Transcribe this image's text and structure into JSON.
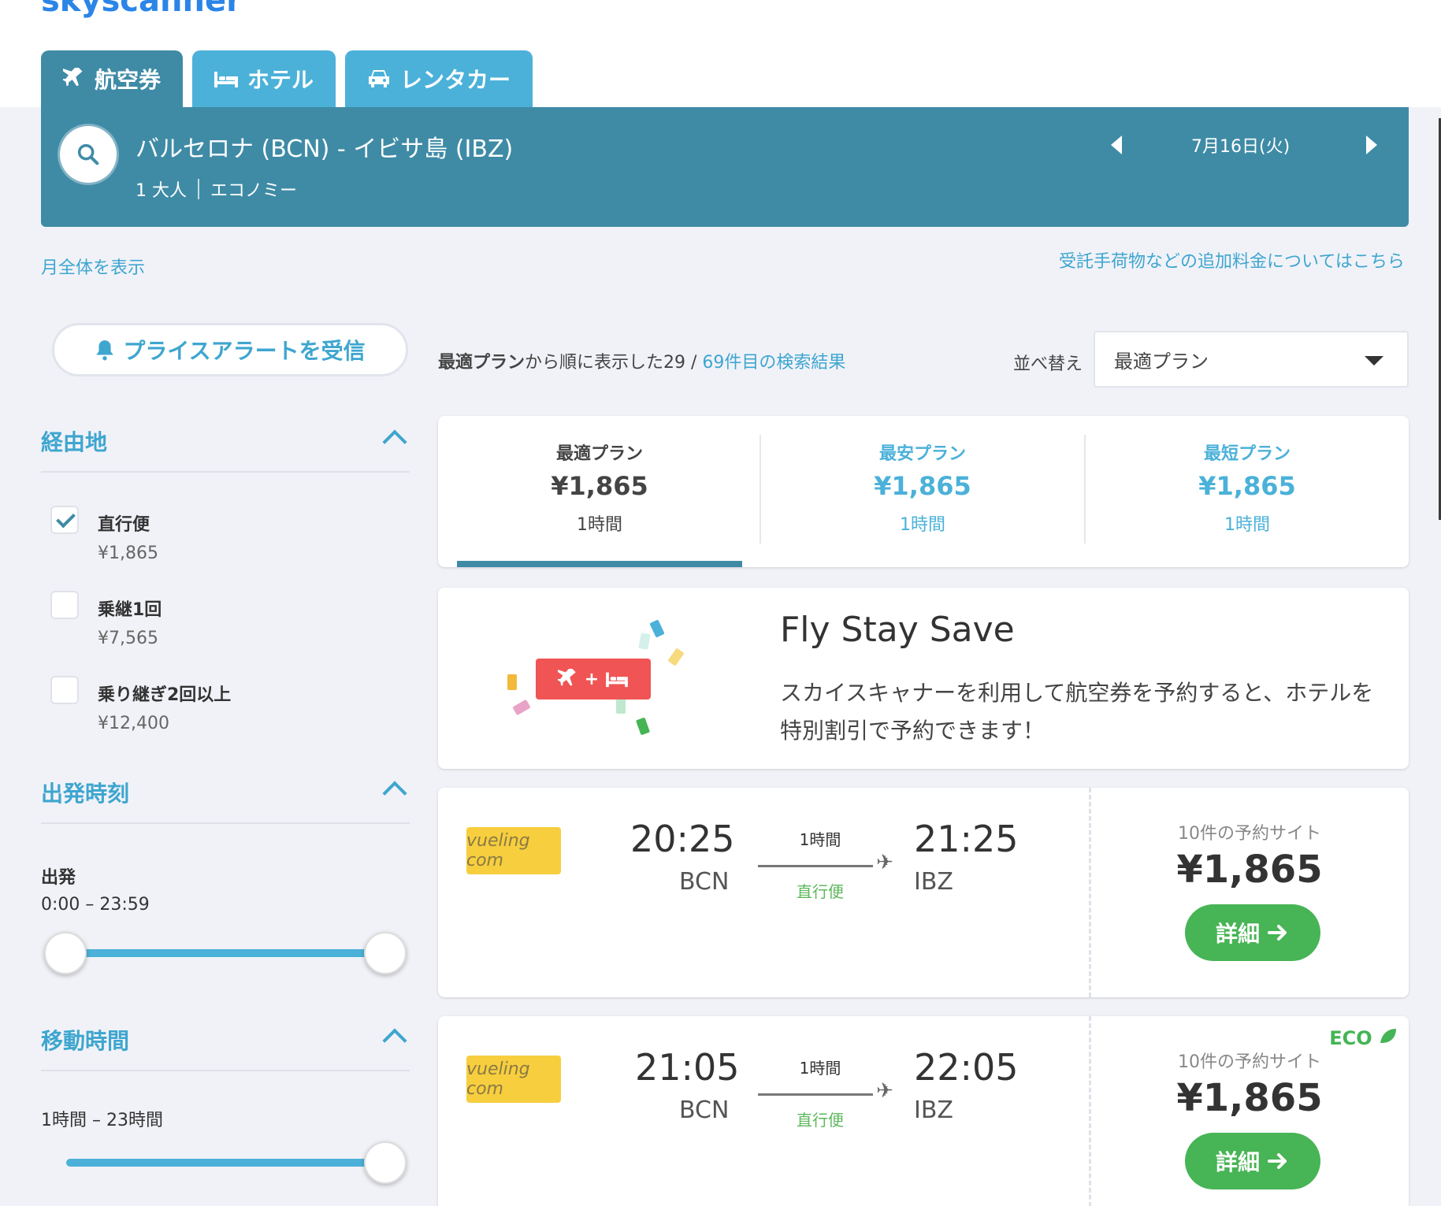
{
  "brand": {
    "logo_text": "skyscanner"
  },
  "tabs": [
    {
      "label": "航空券",
      "icon": "plane-icon",
      "active": true
    },
    {
      "label": "ホテル",
      "icon": "bed-icon",
      "active": false
    },
    {
      "label": "レンタカー",
      "icon": "car-icon",
      "active": false
    }
  ],
  "search": {
    "route": "バルセロナ (BCN) - イビサ島 (IBZ)",
    "passengers": "1 大人",
    "cabin": "エコノミー",
    "date": "7月16日(火)"
  },
  "links": {
    "month_view": "月全体を表示",
    "baggage_fees": "受託手荷物などの追加料金についてはこちら"
  },
  "price_alert": {
    "label": "プライスアラートを受信"
  },
  "results": {
    "prefix": "最適プラン",
    "middle": "から順に表示した29 / ",
    "total_link": "69件目の検索結果"
  },
  "sort": {
    "label": "並べ替え",
    "selected": "最適プラン"
  },
  "filters": {
    "stops": {
      "title": "経由地",
      "options": [
        {
          "label": "直行便",
          "price": "¥1,865",
          "checked": true
        },
        {
          "label": "乗継1回",
          "price": "¥7,565",
          "checked": false
        },
        {
          "label": "乗り継ぎ2回以上",
          "price": "¥12,400",
          "checked": false
        }
      ]
    },
    "departure": {
      "title": "出発時刻",
      "label": "出発",
      "range": "0:00 – 23:59"
    },
    "duration": {
      "title": "移動時間",
      "range": "1時間 – 23時間"
    }
  },
  "sort_tabs": [
    {
      "title": "最適プラン",
      "price": "¥1,865",
      "duration": "1時間",
      "selected": true
    },
    {
      "title": "最安プラン",
      "price": "¥1,865",
      "duration": "1時間",
      "selected": false
    },
    {
      "title": "最短プラン",
      "price": "¥1,865",
      "duration": "1時間",
      "selected": false
    }
  ],
  "promo": {
    "title": "Fly Stay Save",
    "text": "スカイスキャナーを利用して航空券を予約すると、ホテルを特別割引で予約できます！",
    "badge_plus": "+"
  },
  "flights": [
    {
      "airline": "vueling com",
      "dep_time": "20:25",
      "dep_code": "BCN",
      "arr_time": "21:25",
      "arr_code": "IBZ",
      "duration": "1時間",
      "stops": "直行便",
      "sites": "10件の予約サイト",
      "price": "¥1,865",
      "button": "詳細",
      "eco": ""
    },
    {
      "airline": "vueling com",
      "dep_time": "21:05",
      "dep_code": "BCN",
      "arr_time": "22:05",
      "arr_code": "IBZ",
      "duration": "1時間",
      "stops": "直行便",
      "sites": "10件の予約サイト",
      "price": "¥1,865",
      "button": "詳細",
      "eco": "ECO"
    }
  ],
  "colors": {
    "primary": "#3f8ba6",
    "tab": "#4bb1d9",
    "link": "#3ea6cf",
    "green": "#47b455",
    "promo_red": "#f05454"
  }
}
